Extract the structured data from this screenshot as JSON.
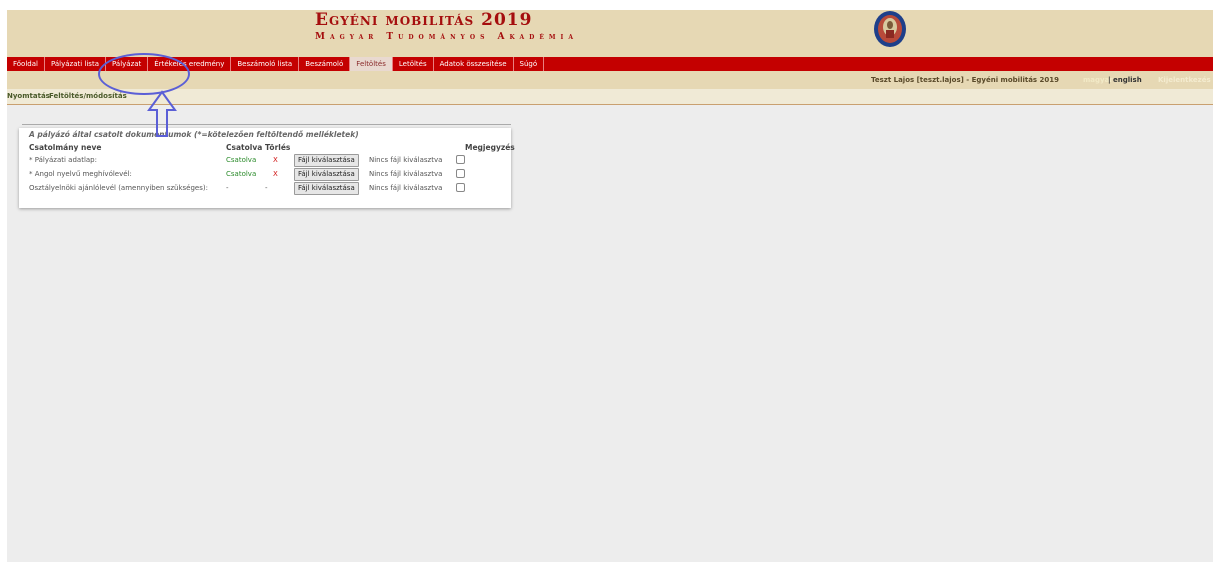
{
  "header": {
    "title": "Egyéni mobilitás 2019",
    "subtitle": "Magyar Tudományos Akadémia",
    "logo_icon": "academy-seal-icon"
  },
  "nav": {
    "items": [
      "Főoldal",
      "Pályázati lista",
      "Pályázat",
      "Értékelés eredmény",
      "Beszámoló lista",
      "Beszámoló",
      "Feltöltés",
      "Letöltés",
      "Adatok összesítése",
      "Súgó"
    ],
    "active": "Feltöltés"
  },
  "userbar": {
    "user": "Teszt Lajos [teszt.lajos] - Egyéni mobilitás 2019",
    "lang_hu": "magyar",
    "lang_en": "| english",
    "logout": "Kijelentkezés"
  },
  "subnav": {
    "print": "Nyomtatás",
    "upload": "Feltöltés/módosítás"
  },
  "attachments": {
    "title": "A pályázó által csatolt dokumentumok (*=kötelezően feltöltendő mellékletek)",
    "headers": {
      "name": "Csatolmány neve",
      "attached": "Csatolva",
      "delete": "Törlés",
      "note": "Megjegyzés"
    },
    "rows": [
      {
        "name": "* Pályázati adatlap:",
        "status": "Csatolva",
        "delete": "X",
        "button": "Fájl kiválasztása",
        "file": "Nincs fájl kiválasztva"
      },
      {
        "name": "* Angol nyelvű meghívólevél:",
        "status": "Csatolva",
        "delete": "X",
        "button": "Fájl kiválasztása",
        "file": "Nincs fájl kiválasztva"
      },
      {
        "name": "Osztályelnöki ajánlólevél (amennyiben szükséges):",
        "status": "-",
        "delete": "-",
        "button": "Fájl kiválasztása",
        "file": "Nincs fájl kiválasztva"
      }
    ]
  },
  "annotation": {
    "highlight_color": "#5b5fd6"
  }
}
